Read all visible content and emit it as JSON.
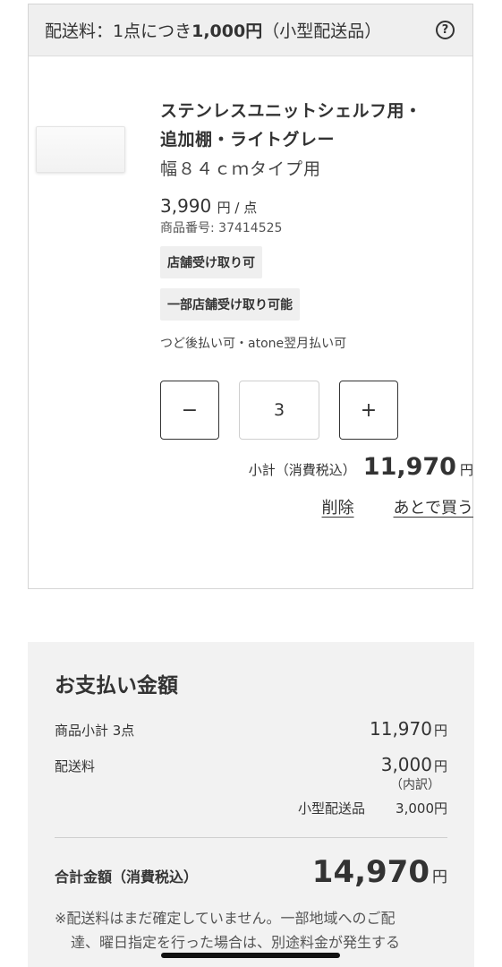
{
  "cart": {
    "shipping_header_prefix": "配送料：1点につき",
    "shipping_header_amount": "1,000円",
    "shipping_header_suffix": "（小型配送品）",
    "help_icon": "question-circle-icon",
    "item": {
      "name": "ステンレスユニットシェルフ用・追加棚・ライトグレー",
      "variant": "幅８４ｃｍタイプ用",
      "price": "3,990",
      "price_unit": "円 / 点",
      "sku": "商品番号: 37414525",
      "badges": [
        "店舗受け取り可",
        "一部店舗受け取り可能"
      ],
      "payment_note": "つど後払い可・atone翌月払い可",
      "quantity": "3",
      "minus_label": "−",
      "plus_label": "+",
      "subtotal_label": "小計（消費税込）",
      "subtotal_amount": "11,970",
      "subtotal_yen": "円",
      "delete_label": "削除",
      "later_label": "あとで買う"
    }
  },
  "summary": {
    "title": "お支払い金額",
    "items_label": "商品小計 3点",
    "items_amount": "11,970",
    "shipping_label": "配送料",
    "shipping_amount": "3,000",
    "yen": "円",
    "breakdown_label": "（内訳）",
    "breakdown_item": "小型配送品",
    "breakdown_amount": "3,000円",
    "total_label": "合計金額（消費税込）",
    "total_amount": "14,970",
    "note_line1": "※配送料はまだ確定していません。一部地域へのご配",
    "note_line2": "達、曜日指定を行った場合は、別途料金が発生する"
  }
}
